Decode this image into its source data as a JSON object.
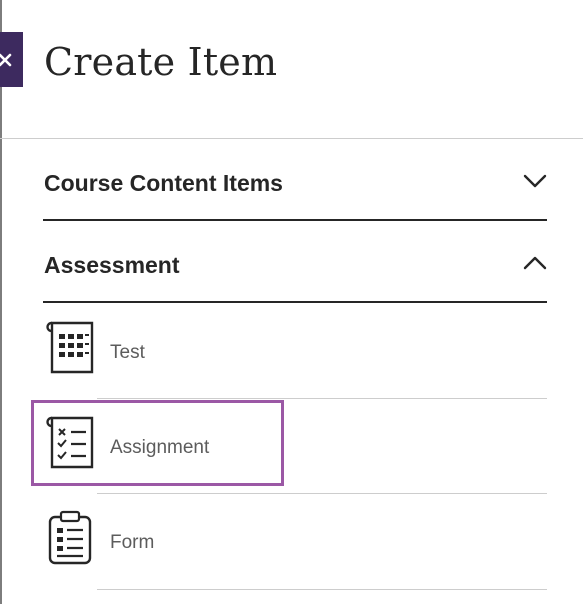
{
  "panel": {
    "title": "Create Item",
    "close_icon": "close-icon"
  },
  "sections": [
    {
      "label": "Course Content Items",
      "state": "collapsed",
      "icon": "chevron-down-icon"
    },
    {
      "label": "Assessment",
      "state": "expanded",
      "icon": "chevron-up-icon"
    }
  ],
  "assessment_items": [
    {
      "label": "Test",
      "icon": "test-icon"
    },
    {
      "label": "Assignment",
      "icon": "assignment-icon",
      "highlighted": true
    },
    {
      "label": "Form",
      "icon": "form-icon"
    }
  ],
  "colors": {
    "accent": "#3d2a5f",
    "highlight": "#9b58a5",
    "text": "#262626",
    "item_text": "#5c5c5c"
  }
}
